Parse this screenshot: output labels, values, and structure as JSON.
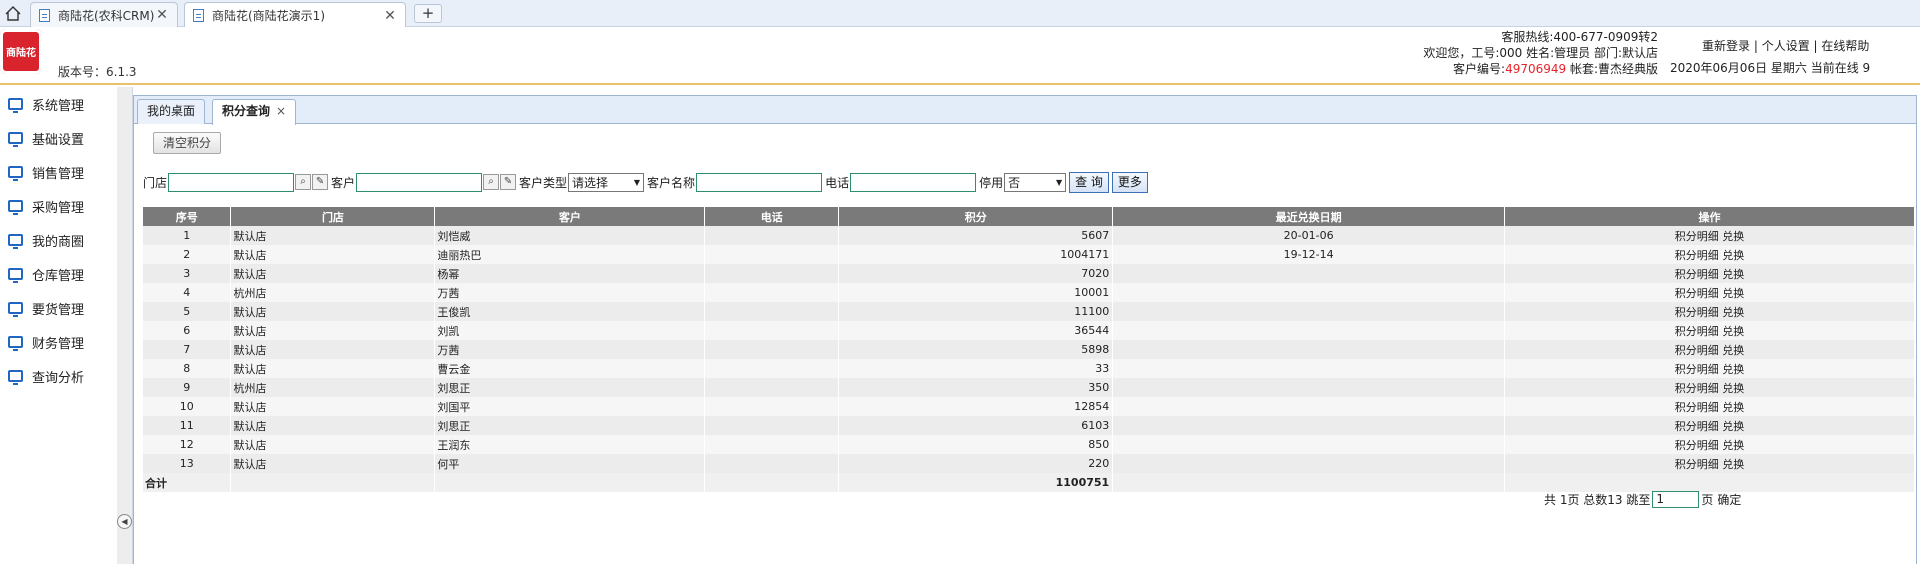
{
  "browser": {
    "tabs": [
      {
        "title": "商陆花(农科CRM)"
      },
      {
        "title": "商陆花(商陆花演示1)"
      }
    ],
    "new_tab_label": "+",
    "close_glyph": "✕"
  },
  "header": {
    "logo_text": "商陆花",
    "version": "版本号：6.1.3",
    "hotline": "客服热线:400-677-0909转2",
    "welcome": "欢迎您，工号:000 姓名:管理员 部门:默认店",
    "customer_no_label": "客户编号:",
    "customer_no": "49706949",
    "account_set": " 帐套:曹杰经典版",
    "links": [
      "重新登录",
      "个人设置",
      "在线帮助"
    ],
    "date_line": "2020年06月06日 星期六 当前在线 9"
  },
  "sidebar": {
    "items": [
      "系统管理",
      "基础设置",
      "销售管理",
      "采购管理",
      "我的商圈",
      "仓库管理",
      "要货管理",
      "财务管理",
      "查询分析"
    ]
  },
  "inner_tabs": [
    {
      "label": "我的桌面"
    },
    {
      "label": "积分查询",
      "close": "×"
    }
  ],
  "toolbar": {
    "clear_points": "清空积分"
  },
  "filters": {
    "store_label": "门店",
    "customer_label": "客户",
    "customer_type_label": "客户类型",
    "customer_type_value": "请选择",
    "customer_name_label": "客户名称",
    "phone_label": "电话",
    "disabled_label": "停用",
    "disabled_value": "否",
    "query_button": "查 询",
    "more_button": "更多"
  },
  "table": {
    "headers": [
      "序号",
      "门店",
      "客户",
      "电话",
      "积分",
      "最近兑换日期",
      "操作"
    ],
    "op_detail": "积分明细",
    "op_redeem": "兑换",
    "rows": [
      {
        "no": "1",
        "store": "默认店",
        "customer": "刘恺威",
        "phone": "",
        "points": "5607",
        "last_date": "20-01-06"
      },
      {
        "no": "2",
        "store": "默认店",
        "customer": "迪丽热巴",
        "phone": "",
        "points": "1004171",
        "last_date": "19-12-14"
      },
      {
        "no": "3",
        "store": "默认店",
        "customer": "杨幂",
        "phone": "",
        "points": "7020",
        "last_date": ""
      },
      {
        "no": "4",
        "store": "杭州店",
        "customer": "万茜",
        "phone": "",
        "points": "10001",
        "last_date": ""
      },
      {
        "no": "5",
        "store": "默认店",
        "customer": "王俊凯",
        "phone": "",
        "points": "11100",
        "last_date": ""
      },
      {
        "no": "6",
        "store": "默认店",
        "customer": "刘凯",
        "phone": "",
        "points": "36544",
        "last_date": ""
      },
      {
        "no": "7",
        "store": "默认店",
        "customer": "万茜",
        "phone": "",
        "points": "5898",
        "last_date": ""
      },
      {
        "no": "8",
        "store": "默认店",
        "customer": "曹云金",
        "phone": "",
        "points": "33",
        "last_date": ""
      },
      {
        "no": "9",
        "store": "杭州店",
        "customer": "刘思正",
        "phone": "",
        "points": "350",
        "last_date": ""
      },
      {
        "no": "10",
        "store": "默认店",
        "customer": "刘国平",
        "phone": "",
        "points": "12854",
        "last_date": ""
      },
      {
        "no": "11",
        "store": "默认店",
        "customer": "刘思正",
        "phone": "",
        "points": "6103",
        "last_date": ""
      },
      {
        "no": "12",
        "store": "默认店",
        "customer": "王润东",
        "phone": "",
        "points": "850",
        "last_date": ""
      },
      {
        "no": "13",
        "store": "默认店",
        "customer": "何平",
        "phone": "",
        "points": "220",
        "last_date": ""
      }
    ],
    "total_label": "合计",
    "total_points": "1100751"
  },
  "pager": {
    "summary": "共 1页 总数13 跳至",
    "page_value": "1",
    "page_suffix": "页",
    "confirm": "确定"
  },
  "colors": {
    "accent_red": "#e8232a",
    "header_rule": "#e9c16b",
    "grid_header": "#7a7a7a",
    "sidebar_icon": "#1f67c2"
  }
}
